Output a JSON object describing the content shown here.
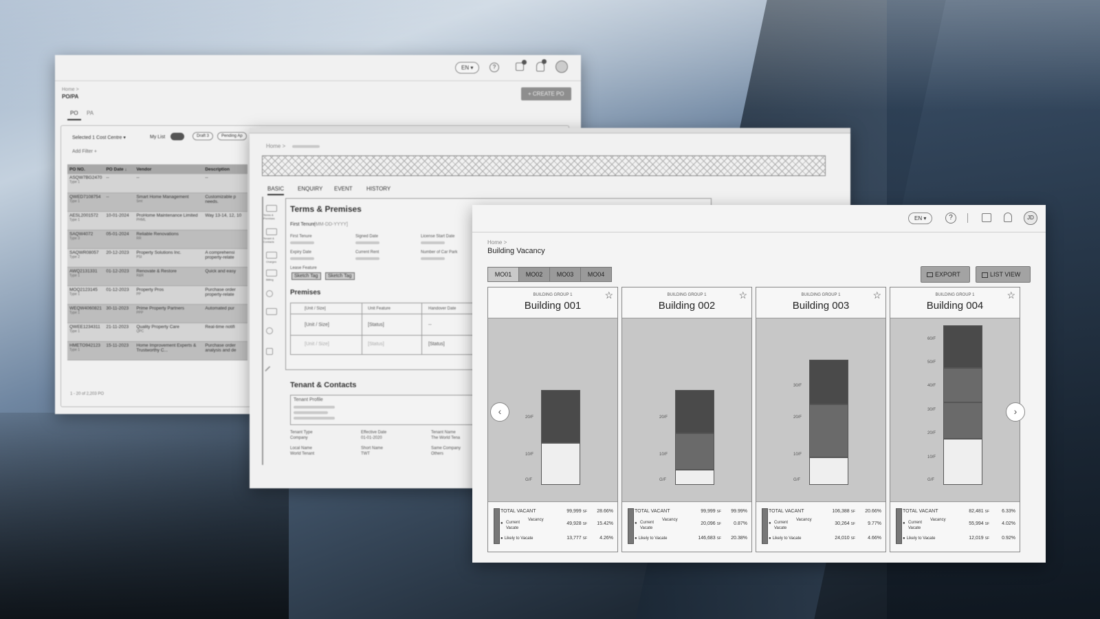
{
  "po_window": {
    "lang": "EN ▾",
    "breadcrumb_home": "Home >",
    "page_title": "PO/PA",
    "create_button": "+ CREATE PO",
    "tabs": [
      "PO",
      "PA"
    ],
    "filter_cost_centre": "Selected 1 Cost Centre ▾",
    "filter_mylist": "My List",
    "chip_draft": "Draft 3",
    "chip_pending": "Pending Ap",
    "add_filter": "Add Filter +",
    "columns": [
      "PO NO.",
      "PO Date ↓",
      "Vendor",
      "Description"
    ],
    "rows": [
      {
        "no": "ASQW7BG2470",
        "type": "Type 1",
        "date": "--",
        "vendor": "--",
        "vendor_sub": "",
        "desc": "--"
      },
      {
        "no": "QWED7108754",
        "type": "Type 1",
        "date": "--",
        "vendor": "Smart Home Management",
        "vendor_sub": "Smt",
        "desc": "Customizable p needs."
      },
      {
        "no": "AESL2001572",
        "type": "Type 1",
        "date": "10-01-2024",
        "vendor": "ProHome Maintenance Limited",
        "vendor_sub": "PHML",
        "desc": "Way 13-14, 12, 10"
      },
      {
        "no": "SAQW4072",
        "type": "Type 3",
        "date": "05-01-2024",
        "vendor": "Reliable Renovations",
        "vendor_sub": "RR",
        "desc": ""
      },
      {
        "no": "SAQWR08057",
        "type": "Type 2",
        "date": "20-12-2023",
        "vendor": "Property Solutions Inc.",
        "vendor_sub": "PSI",
        "desc": "A comprehensi property-relate"
      },
      {
        "no": "AWQ2131331",
        "type": "Type 1",
        "date": "01-12-2023",
        "vendor": "Renovate & Restore",
        "vendor_sub": "R&R",
        "desc": "Quick and easy"
      },
      {
        "no": "MOQ2123145",
        "type": "Type 1",
        "date": "01-12-2023",
        "vendor": "Property Pros",
        "vendor_sub": "PP",
        "desc": "Purchase order property-relate"
      },
      {
        "no": "WEQW4060821",
        "type": "Type 1",
        "date": "30-11-2023",
        "vendor": "Prime Property Partners",
        "vendor_sub": "PPP",
        "desc": "Automated pur"
      },
      {
        "no": "QWEE1234311",
        "type": "Type 1",
        "date": "21-11-2023",
        "vendor": "Quality Property Care",
        "vendor_sub": "QPC",
        "desc": "Real-time notifi"
      },
      {
        "no": "HMETO942123",
        "type": "Type 1",
        "date": "15-11-2023",
        "vendor": "Home Improvement Experts & Trustworthy C...",
        "vendor_sub": "",
        "desc": "Purchase order analysis and de"
      }
    ],
    "footer": "1 - 20 of 2,203 PO"
  },
  "lease_window": {
    "breadcrumb_home": "Home >",
    "tabs": [
      "BASIC",
      "ENQUIRY",
      "EVENT",
      "HISTORY"
    ],
    "side_labels": [
      "Terms & Premises",
      "Tenant & Contacts",
      "Charges",
      "Billing"
    ],
    "terms_title": "Terms & Premises",
    "first_tenure_label": "First Tenure:",
    "first_tenure_value": "[MM-DD-YYYY]",
    "fields_row1": [
      "First Tenure",
      "Signed Date",
      "License Start Date"
    ],
    "fields_row2": [
      "Expiry Date",
      "Current Rent",
      "Number of Car Park"
    ],
    "lease_feature": "Lease Feature",
    "tags": [
      "Sketch Tag",
      "Sketch Tag"
    ],
    "premises_title": "Premises",
    "premises_cols": [
      "[Unit / Size]",
      "Unit Feature",
      "Handover Date"
    ],
    "premises_row1": [
      "[Unit / Size]",
      "[Status]",
      "--"
    ],
    "premises_row2": [
      "[Unit / Size]",
      "[Status]",
      "[Status]"
    ],
    "tenant_title": "Tenant & Contacts",
    "tenant_profile": "Tenant Profile",
    "tenant_fields": [
      {
        "label": "Tenant Type",
        "value": "Company"
      },
      {
        "label": "Effective Date",
        "value": "01-01-2020"
      },
      {
        "label": "Tenant Name",
        "value": "The World Tena"
      },
      {
        "label": "Local Name",
        "value": "World Tenant"
      },
      {
        "label": "Short Name",
        "value": "TWT"
      },
      {
        "label": "Same Company",
        "value": "Others"
      }
    ]
  },
  "vacancy_window": {
    "lang": "EN ▾",
    "user_initials": "JD",
    "breadcrumb_home": "Home >",
    "page_title": "Building Vacancy",
    "mo_tabs": [
      "MO01",
      "MO02",
      "MO03",
      "MO04"
    ],
    "export_label": "EXPORT",
    "list_view_label": "LIST VIEW",
    "stat_labels": {
      "total": "TOTAL VACANT",
      "current": "Current Vacate",
      "vacancy": "Vacancy",
      "likely": "Likely to Vacate",
      "unit": "SF"
    },
    "buildings": [
      {
        "group": "BUILDING GROUP 1",
        "name": "Building 001",
        "floors": [
          "20/F",
          "10/F",
          "G/F"
        ],
        "total": "99,999",
        "total_pct": "28.66%",
        "current": "49,928",
        "current_pct": "15.42%",
        "likely": "13,777",
        "likely_pct": "4.26%"
      },
      {
        "group": "BUILDING GROUP 1",
        "name": "Building 002",
        "floors": [
          "20/F",
          "10/F",
          "G/F"
        ],
        "total": "99,999",
        "total_pct": "99.99%",
        "current": "20,096",
        "current_pct": "0.87%",
        "likely": "146,683",
        "likely_pct": "20.38%"
      },
      {
        "group": "BUILDING GROUP 1",
        "name": "Building 003",
        "floors": [
          "30/F",
          "20/F",
          "10/F",
          "G/F"
        ],
        "total": "106,388",
        "total_pct": "20.66%",
        "current": "30,264",
        "current_pct": "9.77%",
        "likely": "24,010",
        "likely_pct": "4.66%"
      },
      {
        "group": "BUILDING GROUP 1",
        "name": "Building 004",
        "floors": [
          "60/F",
          "50/F",
          "40/F",
          "30/F",
          "20/F",
          "10/F",
          "G/F"
        ],
        "total": "82,481",
        "total_pct": "6.33%",
        "current": "55,994",
        "current_pct": "4.02%",
        "likely": "12,019",
        "likely_pct": "0.92%"
      }
    ],
    "colors": {
      "dark": "#4a4a4a",
      "mid": "#6a6a6a",
      "light": "#efefef"
    }
  }
}
